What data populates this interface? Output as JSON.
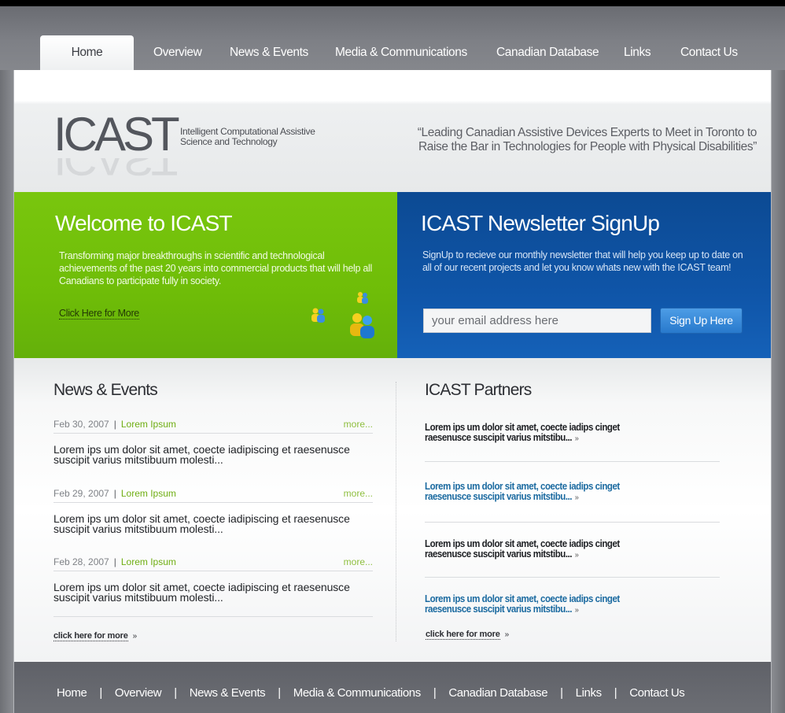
{
  "nav": {
    "items": [
      "Home",
      "Overview",
      "News & Events",
      "Media & Communications",
      "Canadian Database",
      "Links",
      "Contact Us"
    ],
    "active": "Home"
  },
  "header": {
    "logo": "ICAST",
    "tagline_line1": "Intelligent Computational Assistive",
    "tagline_line2": "Science and Technology",
    "quote_line1": "“Leading Canadian Assistive Devices Experts to Meet in Toronto to",
    "quote_line2": "Raise the Bar in Technologies for People with Physical Disabilities”"
  },
  "welcome": {
    "title": "Welcome to ICAST",
    "body": "Transforming major breakthroughs in scientific and technological achievements of the past 20 years into commercial products that will help all Canadians to participate fully in society.",
    "link": "Click Here for More"
  },
  "newsletter": {
    "title": "ICAST Newsletter SignUp",
    "body": "SignUp to recieve our monthly newsletter that will help you keep up to date on all of our recent projects and let you know whats new with the ICAST team!",
    "email_placeholder": "your email address here",
    "button": "Sign Up Here"
  },
  "news": {
    "title": "News & Events",
    "items": [
      {
        "date": "Feb 30, 2007",
        "category": "Lorem Ipsum",
        "more": "more...",
        "body_line1": "Lorem ips um dolor sit amet, coecte iadipiscing et raesenusce",
        "body_line2": "suscipit varius mitstibuum molesti..."
      },
      {
        "date": "Feb 29, 2007",
        "category": "Lorem Ipsum",
        "more": "more...",
        "body_line1": "Lorem ips um dolor sit amet, coecte iadipiscing et raesenusce",
        "body_line2": "suscipit varius mitstibuum molesti..."
      },
      {
        "date": "Feb 28, 2007",
        "category": "Lorem Ipsum",
        "more": "more...",
        "body_line1": "Lorem ips um dolor sit amet, coecte iadipiscing et raesenusce",
        "body_line2": "suscipit varius mitstibuum molesti..."
      }
    ],
    "click_more": "click here for more"
  },
  "partners": {
    "title": "ICAST Partners",
    "items": [
      {
        "line1": "Lorem ips um dolor sit amet, coecte iadips cinget",
        "line2": "raesenusce suscipit varius mitstibu...",
        "color": "#1d1f23"
      },
      {
        "line1": "Lorem ips um dolor sit amet, coecte iadips cinget",
        "line2": "raesenusce suscipit varius mitstibu...",
        "color": "#1b6aa0"
      },
      {
        "line1": "Lorem ips um dolor sit amet, coecte iadips cinget",
        "line2": "raesenusce suscipit varius mitstibu...",
        "color": "#1d1f23"
      },
      {
        "line1": "Lorem ips um dolor sit amet, coecte iadips cinget",
        "line2": "raesenusce suscipit varius mitstibu...",
        "color": "#1b6aa0"
      }
    ],
    "click_more": "click here for more"
  },
  "footer": {
    "items": [
      "Home",
      "Overview",
      "News & Events",
      "Media & Communications",
      "Canadian Database",
      "Links",
      "Contact Us"
    ],
    "separator": "|"
  },
  "colors": {
    "green_panel": "#6fbd08",
    "blue_panel": "#0f55a8",
    "nav_bg": "#7e8086",
    "accent_green": "#6fae13",
    "partner_blue": "#1b6aa0"
  },
  "icons": {
    "arrow": "»",
    "people": "people-icon"
  }
}
